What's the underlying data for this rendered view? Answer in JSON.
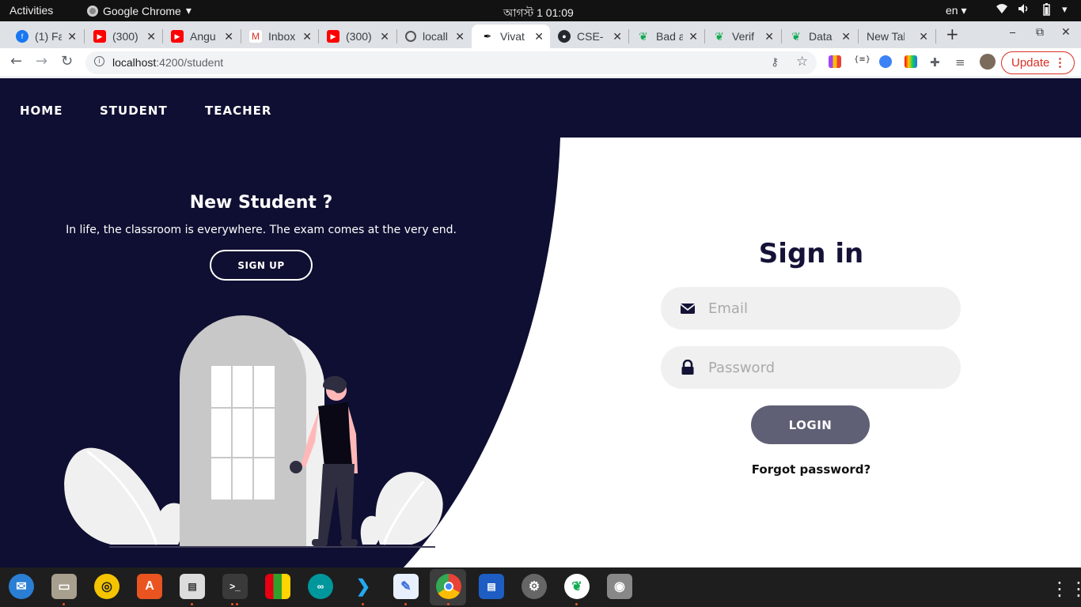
{
  "topbar": {
    "activities": "Activities",
    "app_name": "Google Chrome",
    "clock": "আগস্ট 1  01:09",
    "lang": "en"
  },
  "tabs": [
    {
      "title": "(1) Fa",
      "icon": "facebook-icon"
    },
    {
      "title": "(300)",
      "icon": "youtube-icon"
    },
    {
      "title": "Angu",
      "icon": "youtube-icon"
    },
    {
      "title": "Inbox",
      "icon": "gmail-icon"
    },
    {
      "title": "(300)",
      "icon": "youtube-icon"
    },
    {
      "title": "locall",
      "icon": "globe-icon"
    },
    {
      "title": "Vivat",
      "icon": "vivatech-icon",
      "active": true
    },
    {
      "title": "CSE-",
      "icon": "github-icon"
    },
    {
      "title": "Bad a",
      "icon": "mongodb-icon"
    },
    {
      "title": "Verif",
      "icon": "mongodb-icon"
    },
    {
      "title": "Data",
      "icon": "mongodb-icon"
    },
    {
      "title": "New Tab",
      "icon": "none"
    }
  ],
  "address": {
    "host": "localhost",
    "path": ":4200/student"
  },
  "update_label": "Update",
  "nav": {
    "home": "HOME",
    "student": "STUDENT",
    "teacher": "TEACHER"
  },
  "promo": {
    "title": "New Student ?",
    "text": "In life, the classroom is everywhere. The exam comes at the very end.",
    "signup_label": "SIGN UP"
  },
  "signin": {
    "title": "Sign in",
    "email_placeholder": "Email",
    "password_placeholder": "Password",
    "login_label": "LOGIN",
    "forgot_label": "Forgot password?"
  },
  "colors": {
    "navy": "#0f0f33",
    "field_bg": "#f0f0f0",
    "login_btn": "#5f5f75",
    "title": "#141236"
  }
}
